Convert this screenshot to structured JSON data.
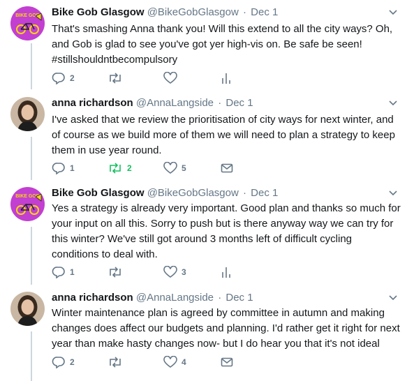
{
  "tweets": [
    {
      "name": "Bike Gob Glasgow",
      "handle": "@BikeGobGlasgow",
      "separator": "·",
      "date": "Dec 1",
      "avatar_label": "BIKE GOB",
      "text": "That's smashing Anna thank you! Will this extend to all the city ways? Oh, and Gob is glad to see you've got yer high-vis on. Be safe be seen! #stillshouldntbecompulsory",
      "replies": "2",
      "retweets": "",
      "likes": "",
      "retweeted": false,
      "last_action": "analytics-icon"
    },
    {
      "name": "anna richardson",
      "handle": "@AnnaLangside",
      "separator": "·",
      "date": "Dec 1",
      "text": "I've asked that we review the prioritisation of city ways for next winter, and of course as we build more of them we will need to plan a strategy to keep them in use year round.",
      "replies": "1",
      "retweets": "2",
      "likes": "5",
      "retweeted": true,
      "last_action": "message-icon"
    },
    {
      "name": "Bike Gob Glasgow",
      "handle": "@BikeGobGlasgow",
      "separator": "·",
      "date": "Dec 1",
      "avatar_label": "BIKE GOB",
      "text": "Yes a strategy is already very important. Good plan and thanks so much for your input on all this. Sorry to push but is there anyway way we can try for this winter? We've still got around 3 months left of difficult cycling conditions to deal with.",
      "replies": "1",
      "retweets": "",
      "likes": "3",
      "retweeted": false,
      "last_action": "analytics-icon"
    },
    {
      "name": "anna richardson",
      "handle": "@AnnaLangside",
      "separator": "·",
      "date": "Dec 1",
      "text": "Winter maintenance plan is agreed by committee in autumn and making changes does affect our budgets and planning. I'd rather get it right for next year than make hasty changes now- but I do hear you that it's not ideal",
      "replies": "2",
      "retweets": "",
      "likes": "4",
      "retweeted": false,
      "last_action": "message-icon"
    }
  ],
  "colors": {
    "text": "#14171a",
    "secondary": "#657786",
    "icon": "#657786",
    "retweet_active": "#17bf63",
    "thread_line": "#ccd6dd",
    "bikegob_bg": "#c23fd1",
    "bikegob_accent": "#f5d60f"
  }
}
